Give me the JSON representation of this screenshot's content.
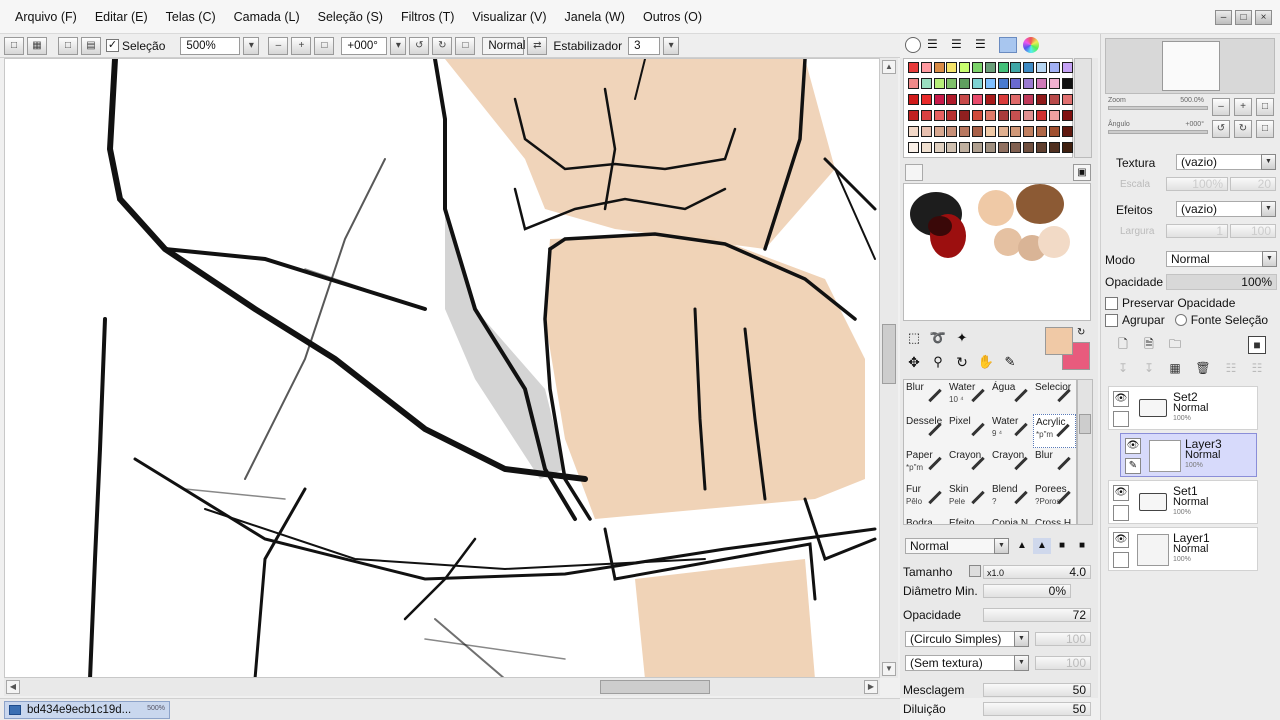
{
  "menubar": {
    "items": [
      {
        "label": "Arquivo (F)"
      },
      {
        "label": "Editar (E)"
      },
      {
        "label": "Telas (C)"
      },
      {
        "label": "Camada (L)"
      },
      {
        "label": "Seleção (S)"
      },
      {
        "label": "Filtros (T)"
      },
      {
        "label": "Visualizar (V)"
      },
      {
        "label": "Janela (W)"
      },
      {
        "label": "Outros (O)"
      }
    ]
  },
  "toolbar": {
    "selection_label": "Seleção",
    "selection_checked": true,
    "zoom": "500%",
    "rotation": "+000°",
    "blend_mode": "Normal",
    "stabilizer_label": "Estabilizador",
    "stabilizer_value": "3"
  },
  "status": {
    "file_name": "bd434e9ecb1c19d...",
    "file_zoom": "500%"
  },
  "colors": {
    "primary": "#f0c9a6",
    "secondary": "#e85b7d"
  },
  "tools": [
    {
      "name": "Blur",
      "sub": ""
    },
    {
      "name": "Water",
      "sub": "10 ⁴"
    },
    {
      "name": "Água",
      "sub": ""
    },
    {
      "name": "Selecior",
      "sub": ""
    },
    {
      "name": "Dessele",
      "sub": ""
    },
    {
      "name": "Pixel",
      "sub": ""
    },
    {
      "name": "Water",
      "sub": "9 ⁴"
    },
    {
      "name": "Acrylic",
      "sub": "*p\"m"
    },
    {
      "name": "Paper",
      "sub": "*p\"m"
    },
    {
      "name": "Crayon",
      "sub": ""
    },
    {
      "name": "Crayon",
      "sub": ""
    },
    {
      "name": "Blur",
      "sub": ""
    },
    {
      "name": "Fur",
      "sub": "Pêlo"
    },
    {
      "name": "Skin",
      "sub": "Pele"
    },
    {
      "name": "Blend",
      "sub": "?"
    },
    {
      "name": "Porees",
      "sub": "?Poros"
    },
    {
      "name": "Bodra",
      "sub": ""
    },
    {
      "name": "Efeito",
      "sub": ""
    },
    {
      "name": "Copia N",
      "sub": ""
    },
    {
      "name": "Cross H",
      "sub": ""
    }
  ],
  "brush": {
    "mode": "Normal",
    "size_label": "Tamanho",
    "size_mult": "x1.0",
    "size_value": "4.0",
    "min_diameter_label": "Diâmetro Min.",
    "min_diameter_value": "0%",
    "opacity_label": "Opacidade",
    "opacity_value": "72",
    "shape": "(Circulo Simples)",
    "shape_value": "100",
    "texture": "(Sem textura)",
    "texture_value": "100",
    "blend_label": "Mesclagem",
    "blend_value": "50",
    "dilution_label": "Diluição",
    "dilution_value": "50"
  },
  "navigator": {
    "zoom_label": "Zoom",
    "zoom_value": "500.0%",
    "angle_label": "Ângulo",
    "angle_value": "+000°"
  },
  "layer_props": {
    "texture_label": "Textura",
    "texture_value": "(vazio)",
    "texture_scale_label": "Escala",
    "texture_scale_value": "100%",
    "texture_scale_extra": "20",
    "effects_label": "Efeitos",
    "effects_value": "(vazio)",
    "effects_width_label": "Largura",
    "effects_width_value": "1",
    "effects_width_extra": "100",
    "mode_label": "Modo",
    "mode_value": "Normal",
    "opacity_label": "Opacidade",
    "opacity_value": "100%",
    "preserve_label": "Preservar Opacidade",
    "group_label": "Agrupar",
    "source_label": "Fonte Seleção"
  },
  "layers": [
    {
      "name": "Set2",
      "mode": "Normal",
      "opacity": "100%",
      "type": "folder"
    },
    {
      "name": "Layer3",
      "mode": "Normal",
      "opacity": "100%",
      "type": "layer",
      "selected": true
    },
    {
      "name": "Set1",
      "mode": "Normal",
      "opacity": "100%",
      "type": "folder"
    },
    {
      "name": "Layer1",
      "mode": "Normal",
      "opacity": "100%",
      "type": "layer"
    }
  ]
}
